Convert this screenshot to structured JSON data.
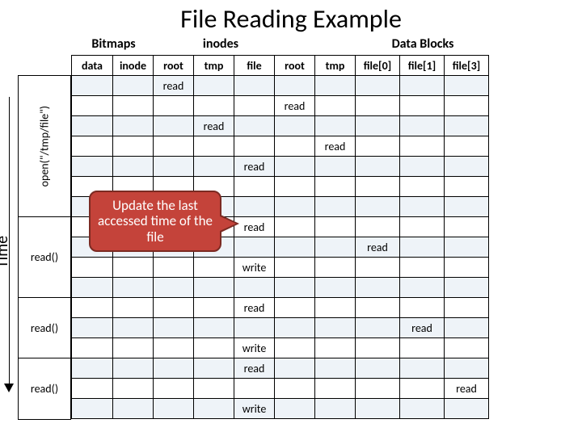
{
  "title": "File Reading Example",
  "groups": {
    "bitmaps": "Bitmaps",
    "inodes": "inodes",
    "datablocks": "Data Blocks"
  },
  "cols": [
    "data",
    "inode",
    "root",
    "tmp",
    "file",
    "root",
    "tmp",
    "file[0]",
    "file[1]",
    "file[3]"
  ],
  "row_labels": {
    "open": "open(\"/tmp/file\")",
    "r1": "read()",
    "r2": "read()",
    "r3": "read()"
  },
  "time_label": "Time",
  "callout": "Update the last accessed time of the file",
  "cells": {
    "r": "read",
    "w": "write"
  },
  "chart_data": {
    "type": "table",
    "title": "File Reading Example",
    "column_groups": [
      {
        "name": "Bitmaps",
        "columns": [
          "data",
          "inode"
        ]
      },
      {
        "name": "inodes",
        "columns": [
          "root",
          "tmp",
          "file"
        ]
      },
      {
        "name": "Data Blocks",
        "columns": [
          "root",
          "tmp",
          "file[0]",
          "file[1]",
          "file[3]"
        ]
      }
    ],
    "row_groups": [
      {
        "label": "open(\"/tmp/file\")",
        "rows": 7
      },
      {
        "label": "read()",
        "rows": 4
      },
      {
        "label": "read()",
        "rows": 3
      },
      {
        "label": "read()",
        "rows": 3
      }
    ],
    "events": [
      {
        "group": 0,
        "row": 0,
        "col": "inodes.root",
        "op": "read"
      },
      {
        "group": 0,
        "row": 1,
        "col": "data.root",
        "op": "read"
      },
      {
        "group": 0,
        "row": 2,
        "col": "inodes.tmp",
        "op": "read"
      },
      {
        "group": 0,
        "row": 3,
        "col": "data.tmp",
        "op": "read"
      },
      {
        "group": 0,
        "row": 4,
        "col": "inodes.file",
        "op": "read"
      },
      {
        "group": 1,
        "row": 0,
        "col": "inodes.file",
        "op": "read"
      },
      {
        "group": 1,
        "row": 1,
        "col": "data.file[0]",
        "op": "read"
      },
      {
        "group": 1,
        "row": 2,
        "col": "inodes.file",
        "op": "write"
      },
      {
        "group": 2,
        "row": 0,
        "col": "inodes.file",
        "op": "read"
      },
      {
        "group": 2,
        "row": 1,
        "col": "data.file[1]",
        "op": "read"
      },
      {
        "group": 2,
        "row": 2,
        "col": "inodes.file",
        "op": "write"
      },
      {
        "group": 3,
        "row": 0,
        "col": "inodes.file",
        "op": "read"
      },
      {
        "group": 3,
        "row": 1,
        "col": "data.file[3]",
        "op": "read"
      },
      {
        "group": 3,
        "row": 2,
        "col": "inodes.file",
        "op": "write"
      }
    ],
    "annotation": "Update the last accessed time of the file"
  }
}
